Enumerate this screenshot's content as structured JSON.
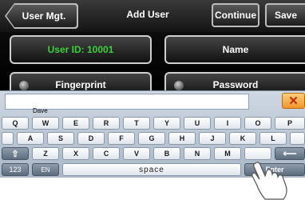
{
  "header": {
    "back_label": "User Mgt.",
    "title": "Add User",
    "continue_label": "Continue",
    "save_label": "Save"
  },
  "form": {
    "user_id": "User ID: 10001",
    "name_label": "Name",
    "fingerprint_label": "Fingerprint",
    "password_label": "Password"
  },
  "keyboard": {
    "input_value": "Dave",
    "close_symbol": "✕",
    "row1": [
      "Q",
      "W",
      "E",
      "R",
      "T",
      "Y",
      "U",
      "I",
      "O",
      "P"
    ],
    "row2": [
      "A",
      "S",
      "D",
      "F",
      "G",
      "H",
      "J",
      "K",
      "L"
    ],
    "row3": [
      "Z",
      "X",
      "C",
      "V",
      "B",
      "N",
      "M"
    ],
    "shift_symbol": "⇧",
    "backspace_symbol": "⟵",
    "num_label": "123",
    "lang_label": "EN",
    "space_label": "space",
    "enter_label": "Enter"
  },
  "colors": {
    "user_id_text": "#3ad23a",
    "close_key_bg": "#f0962a"
  },
  "icons": [
    "back-arrow-icon",
    "radio-icon",
    "close-icon",
    "shift-icon",
    "backspace-icon",
    "hand-pointer-icon"
  ]
}
